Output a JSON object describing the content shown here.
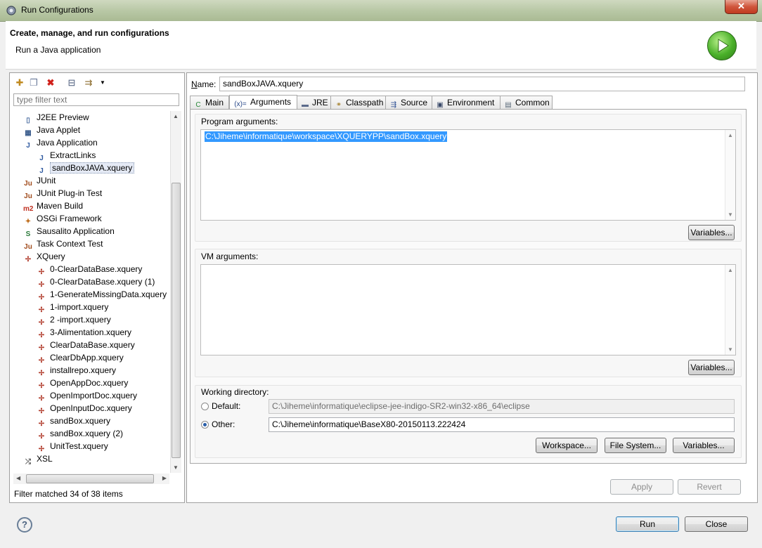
{
  "window": {
    "title": "Run Configurations",
    "close_label": "✕"
  },
  "header": {
    "title": "Create, manage, and run configurations",
    "subtitle": "Run a Java application"
  },
  "left": {
    "filter_placeholder": "type filter text",
    "tree": [
      {
        "label": "J2EE Preview",
        "level": 0,
        "icon": "j2ee-preview-icon",
        "glyph": "▯",
        "color": "#4a6da0"
      },
      {
        "label": "Java Applet",
        "level": 0,
        "icon": "java-applet-icon",
        "glyph": "▦",
        "color": "#3a5c8c"
      },
      {
        "label": "Java Application",
        "level": 0,
        "icon": "java-application-icon",
        "glyph": "J",
        "color": "#2f5aa0"
      },
      {
        "label": "ExtractLinks",
        "level": 1,
        "icon": "java-application-icon",
        "glyph": "J",
        "color": "#2f5aa0"
      },
      {
        "label": "sandBoxJAVA.xquery",
        "level": 1,
        "icon": "java-application-icon",
        "glyph": "J",
        "color": "#2f5aa0",
        "selected": true
      },
      {
        "label": "JUnit",
        "level": 0,
        "icon": "junit-icon",
        "glyph": "Ju",
        "color": "#a04a1a"
      },
      {
        "label": "JUnit Plug-in Test",
        "level": 0,
        "icon": "junit-plugin-icon",
        "glyph": "Ju",
        "color": "#a04a1a"
      },
      {
        "label": "Maven Build",
        "level": 0,
        "icon": "maven-icon",
        "glyph": "m2",
        "color": "#c03020"
      },
      {
        "label": "OSGi Framework",
        "level": 0,
        "icon": "osgi-icon",
        "glyph": "✦",
        "color": "#c07020"
      },
      {
        "label": "Sausalito Application",
        "level": 0,
        "icon": "sausalito-icon",
        "glyph": "S",
        "color": "#2a7a3a"
      },
      {
        "label": "Task Context Test",
        "level": 0,
        "icon": "task-context-icon",
        "glyph": "Ju",
        "color": "#a04a1a"
      },
      {
        "label": "XQuery",
        "level": 0,
        "icon": "xquery-icon",
        "glyph": "✢",
        "color": "#b03a2a"
      },
      {
        "label": "0-ClearDataBase.xquery",
        "level": 1,
        "icon": "xquery-icon",
        "glyph": "✢",
        "color": "#b03a2a"
      },
      {
        "label": "0-ClearDataBase.xquery (1)",
        "level": 1,
        "icon": "xquery-icon",
        "glyph": "✢",
        "color": "#b03a2a"
      },
      {
        "label": "1-GenerateMissingData.xquery",
        "level": 1,
        "icon": "xquery-icon",
        "glyph": "✢",
        "color": "#b03a2a"
      },
      {
        "label": "1-import.xquery",
        "level": 1,
        "icon": "xquery-icon",
        "glyph": "✢",
        "color": "#b03a2a"
      },
      {
        "label": "2 -import.xquery",
        "level": 1,
        "icon": "xquery-icon",
        "glyph": "✢",
        "color": "#b03a2a"
      },
      {
        "label": "3-Alimentation.xquery",
        "level": 1,
        "icon": "xquery-icon",
        "glyph": "✢",
        "color": "#b03a2a"
      },
      {
        "label": "ClearDataBase.xquery",
        "level": 1,
        "icon": "xquery-icon",
        "glyph": "✢",
        "color": "#b03a2a"
      },
      {
        "label": "ClearDbApp.xquery",
        "level": 1,
        "icon": "xquery-icon",
        "glyph": "✢",
        "color": "#b03a2a"
      },
      {
        "label": "installrepo.xquery",
        "level": 1,
        "icon": "xquery-icon",
        "glyph": "✢",
        "color": "#b03a2a"
      },
      {
        "label": "OpenAppDoc.xquery",
        "level": 1,
        "icon": "xquery-icon",
        "glyph": "✢",
        "color": "#b03a2a"
      },
      {
        "label": "OpenImportDoc.xquery",
        "level": 1,
        "icon": "xquery-icon",
        "glyph": "✢",
        "color": "#b03a2a"
      },
      {
        "label": "OpenInputDoc.xquery",
        "level": 1,
        "icon": "xquery-icon",
        "glyph": "✢",
        "color": "#b03a2a"
      },
      {
        "label": "sandBox.xquery",
        "level": 1,
        "icon": "xquery-icon",
        "glyph": "✢",
        "color": "#b03a2a"
      },
      {
        "label": "sandBox.xquery (2)",
        "level": 1,
        "icon": "xquery-icon",
        "glyph": "✢",
        "color": "#b03a2a"
      },
      {
        "label": "UnitTest.xquery",
        "level": 1,
        "icon": "xquery-icon",
        "glyph": "✢",
        "color": "#b03a2a"
      },
      {
        "label": "XSL",
        "level": 0,
        "icon": "xsl-icon",
        "glyph": "⤮",
        "color": "#555555"
      }
    ],
    "filter_status": "Filter matched 34 of 38 items"
  },
  "right": {
    "name_label": "Name:",
    "name_value": "sandBoxJAVA.xquery",
    "tabs": [
      {
        "label": "Main",
        "icon": "main-tab-icon",
        "glyph": "C",
        "color": "#2a8a3a"
      },
      {
        "label": "Arguments",
        "icon": "arguments-tab-icon",
        "glyph": "(x)=",
        "color": "#2a4a8a",
        "active": true
      },
      {
        "label": "JRE",
        "icon": "jre-tab-icon",
        "glyph": "▬",
        "color": "#5a6a8a"
      },
      {
        "label": "Classpath",
        "icon": "classpath-tab-icon",
        "glyph": "⚭",
        "color": "#a07a20"
      },
      {
        "label": "Source",
        "icon": "source-tab-icon",
        "glyph": "⇶",
        "color": "#3a5a9a"
      },
      {
        "label": "Environment",
        "icon": "environment-tab-icon",
        "glyph": "▣",
        "color": "#3a4a6a"
      },
      {
        "label": "Common",
        "icon": "common-tab-icon",
        "glyph": "▤",
        "color": "#5a6a7a"
      }
    ],
    "program_args_label": "Program arguments:",
    "program_args_value": "C:\\Jiheme\\informatique\\workspace\\XQUERYPP\\sandBox.xquery",
    "vm_args_label": "VM arguments:",
    "vm_args_value": "",
    "variables_label": "Variables...",
    "working_dir_label": "Working directory:",
    "default_label": "Default:",
    "default_value": "C:\\Jiheme\\informatique\\eclipse-jee-indigo-SR2-win32-x86_64\\eclipse",
    "other_label": "Other:",
    "other_value": "C:\\Jiheme\\informatique\\BaseX80-20150113.222424",
    "workspace_label": "Workspace...",
    "filesystem_label": "File System...",
    "apply_label": "Apply",
    "revert_label": "Revert"
  },
  "footer": {
    "help_label": "?",
    "run_label": "Run",
    "close_label": "Close"
  }
}
